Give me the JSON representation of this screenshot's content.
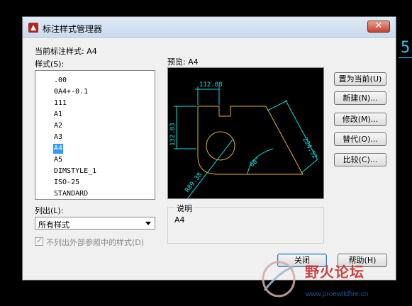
{
  "dialog": {
    "title": "标注样式管理器",
    "current_style_label": "当前标注样式: A4",
    "styles_label": "样式(S):",
    "preview_label": "预览: A4",
    "list_label": "列出(L):",
    "list_value": "所有样式",
    "exclude_xref_label": "不列出外部参照中的样式(D)",
    "desc_title": "说明",
    "desc_value": "A4",
    "close_glyph": "✕"
  },
  "styles": {
    "items": [
      ".00",
      "0A4+-0.1",
      "111",
      "A1",
      "A2",
      "A3",
      "A4",
      "A5",
      "DIMSTYLE_1",
      "ISO-25",
      "STANDARD"
    ],
    "selected": "A4"
  },
  "buttons": {
    "set_current": "置为当前(U)",
    "new": "新建(N)...",
    "modify": "修改(M)...",
    "override": "替代(O)...",
    "compare": "比较(C)...",
    "close": "关闭",
    "help": "帮助(H)"
  },
  "preview_dims": {
    "d1": "112.88",
    "d2": "132.83",
    "d3": "224.52",
    "d4": "60°",
    "d5": "R89.38"
  },
  "colors": {
    "dim_line": "#00e5e5",
    "geometry": "#e0b030",
    "selection": "#3399ff"
  },
  "overlay": {
    "right_digit": "5",
    "watermark_title": "野火论坛",
    "watermark_url": "www.proewildfire.cn"
  }
}
